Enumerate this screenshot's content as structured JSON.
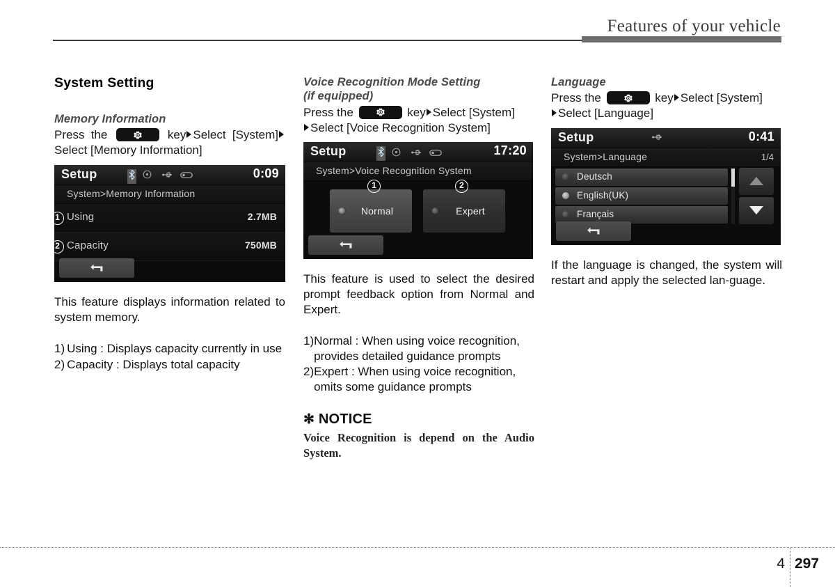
{
  "header": {
    "title": "Features of your vehicle"
  },
  "footer": {
    "chapter": "4",
    "page": "297"
  },
  "column1": {
    "section_title": "System Setting",
    "sub_title": "Memory Information",
    "instruction": {
      "line1_pre": "Press the",
      "line1_mid": "key",
      "line1_post": "Select [System]",
      "line2": "Select [Memory Information]"
    },
    "device": {
      "title": "Setup",
      "clock": "0:09",
      "breadcrumb": "System>Memory Information",
      "rows": [
        {
          "callout": "1",
          "label": "Using",
          "value": "2.7MB"
        },
        {
          "callout": "2",
          "label": "Capacity",
          "value": "750MB"
        }
      ],
      "back_label": "back-arrow"
    },
    "paragraph": "This feature displays information related to system memory.",
    "list": [
      {
        "marker": "1)",
        "text": "Using : Displays capacity currently in use"
      },
      {
        "marker": "2)",
        "text": "Capacity : Displays total capacity"
      }
    ]
  },
  "column2": {
    "sub_title_line1": "Voice Recognition Mode Setting",
    "sub_title_line2": "(if equipped)",
    "instruction": {
      "line1_pre": "Press the",
      "line1_mid": "key",
      "line1_post": "Select [System]",
      "line2": "Select [Voice Recognition System]"
    },
    "device": {
      "title": "Setup",
      "clock": "17:20",
      "breadcrumb": "System>Voice Recognition System",
      "options": [
        {
          "callout": "1",
          "label": "Normal",
          "selected": true
        },
        {
          "callout": "2",
          "label": "Expert",
          "selected": false
        }
      ],
      "back_label": "back-arrow"
    },
    "paragraph": "This feature is used to select the desired prompt feedback option from Normal and Expert.",
    "list": [
      {
        "marker": "1)",
        "text": "Normal : When using voice recognition, provides detailed guidance prompts"
      },
      {
        "marker": "2)",
        "text": "Expert : When using voice recognition, omits some guidance prompts"
      }
    ],
    "notice": {
      "heading": "NOTICE",
      "asterisk": "✻",
      "body": "Voice Recognition is depend on the Audio System."
    }
  },
  "column3": {
    "sub_title": "Language",
    "instruction": {
      "line1_pre": "Press the",
      "line1_mid": "key",
      "line1_post": "Select [System]",
      "line2": "Select [Language]"
    },
    "device": {
      "title": "Setup",
      "clock": "0:41",
      "breadcrumb": "System>Language",
      "page_indicator": "1/4",
      "languages": [
        {
          "label": "Deutsch",
          "selected": false
        },
        {
          "label": "English(UK)",
          "selected": true
        },
        {
          "label": "Français",
          "selected": false
        }
      ],
      "back_label": "back-arrow"
    },
    "paragraph": "If the language is changed, the system will restart and apply the selected lan-guage."
  }
}
